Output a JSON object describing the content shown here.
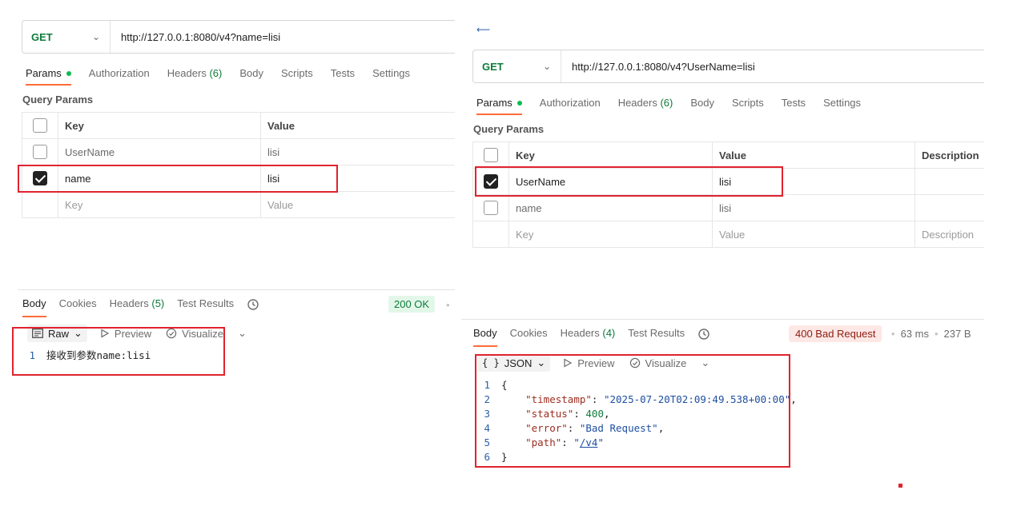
{
  "left": {
    "method": "GET",
    "url": "http://127.0.0.1:8080/v4?name=lisi",
    "req_tabs": [
      {
        "label": "Params"
      },
      {
        "label": "Authorization"
      },
      {
        "label": "Headers",
        "count": "(6)"
      },
      {
        "label": "Body"
      },
      {
        "label": "Scripts"
      },
      {
        "label": "Tests"
      },
      {
        "label": "Settings"
      }
    ],
    "query_params_label": "Query Params",
    "columns": {
      "key": "Key",
      "value": "Value"
    },
    "rows": [
      {
        "key": "UserName",
        "value": "lisi",
        "checked": false
      },
      {
        "key": "name",
        "value": "lisi",
        "checked": true
      }
    ],
    "placeholder": {
      "key": "Key",
      "value": "Value"
    },
    "resp_tabs": [
      {
        "label": "Body"
      },
      {
        "label": "Cookies"
      },
      {
        "label": "Headers",
        "count": "(5)"
      },
      {
        "label": "Test Results"
      }
    ],
    "status": "200 OK",
    "format": {
      "selected": "Raw",
      "preview": "Preview",
      "visualize": "Visualize"
    },
    "body_lines": [
      {
        "n": "1",
        "text": "接收到参数name:lisi"
      }
    ]
  },
  "right": {
    "method": "GET",
    "url": "http://127.0.0.1:8080/v4?UserName=lisi",
    "req_tabs": [
      {
        "label": "Params"
      },
      {
        "label": "Authorization"
      },
      {
        "label": "Headers",
        "count": "(6)"
      },
      {
        "label": "Body"
      },
      {
        "label": "Scripts"
      },
      {
        "label": "Tests"
      },
      {
        "label": "Settings"
      }
    ],
    "query_params_label": "Query Params",
    "columns": {
      "key": "Key",
      "value": "Value",
      "description": "Description"
    },
    "rows": [
      {
        "key": "UserName",
        "value": "lisi",
        "checked": true
      },
      {
        "key": "name",
        "value": "lisi",
        "checked": false
      }
    ],
    "placeholder": {
      "key": "Key",
      "value": "Value",
      "description": "Description"
    },
    "resp_tabs": [
      {
        "label": "Body"
      },
      {
        "label": "Cookies"
      },
      {
        "label": "Headers",
        "count": "(4)"
      },
      {
        "label": "Test Results"
      }
    ],
    "status": "400 Bad Request",
    "time": "63 ms",
    "size": "237 B",
    "format": {
      "selected": "JSON",
      "preview": "Preview",
      "visualize": "Visualize"
    },
    "json": {
      "open": "{",
      "close": "}",
      "timestamp_key": "\"timestamp\"",
      "timestamp_val": "\"2025-07-20T02:09:49.538+00:00\"",
      "status_key": "\"status\"",
      "status_val": "400",
      "error_key": "\"error\"",
      "error_val": "\"Bad Request\"",
      "path_key": "\"path\"",
      "path_val": "/v4"
    },
    "line_numbers": [
      "1",
      "2",
      "3",
      "4",
      "5",
      "6"
    ]
  },
  "colors": {
    "accent": "#ff6c37",
    "success": "#0f7b3b",
    "error_red": "#e0232e"
  }
}
